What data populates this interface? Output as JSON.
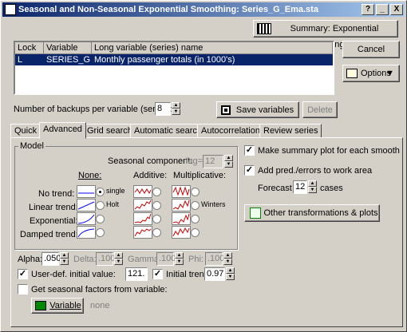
{
  "title": "Seasonal and Non-Seasonal Exponential Smoothing: Series_G_Ema.sta",
  "title_buttons": [
    "?",
    "_",
    "X"
  ],
  "summary_btn": "Summary:  Exponential smoothing)",
  "cancel_btn": "Cancel",
  "options_btn": "Options",
  "list": {
    "headers": [
      "Lock",
      "Variable",
      "Long variable (series) name"
    ],
    "row": [
      "L",
      "SERIES_G",
      "Monthly passenger totals (in 1000's)"
    ]
  },
  "backups_label": "Number of backups per variable (series):",
  "backups_value": "8",
  "save_btn": "Save variables",
  "delete_btn": "Delete",
  "tabs": [
    "Quick",
    "Advanced",
    "Grid search",
    "Automatic search",
    "Autocorrelations",
    "Review series"
  ],
  "model": {
    "group": "Model",
    "seasonal_label": "Seasonal component:",
    "lag_label": "lag=",
    "lag_value": "12",
    "col_none": "None:",
    "col_additive": "Additive:",
    "col_mult": "Multiplicative:",
    "rows": [
      "No trend:",
      "Linear trend:",
      "Exponential:",
      "Damped trend:"
    ],
    "single": "single",
    "holt": "Holt",
    "winters": "Winters"
  },
  "params": {
    "alpha_label": "Alpha:",
    "alpha": ".050",
    "delta_label": "Delta:",
    "delta": ".100",
    "gamma_label": "Gamma:",
    "gamma": ".100",
    "phi_label": "Phi:",
    "phi": ".100"
  },
  "userdef_label": "User-def. initial value:",
  "userdef_value": "121.",
  "inittrend_label": "Initial trend:",
  "inittrend_value": "0.97",
  "seasonal_factors_label": "Get seasonal factors from variable:",
  "variable_btn": "Variable",
  "none_text": "none",
  "summary_plot_label": "Make summary plot for each smooth",
  "add_pred_label": "Add pred./errors to work area",
  "forecast_label": "Forecast",
  "forecast_value": "12",
  "cases_label": "cases",
  "other_btn": "Other transformations & plots"
}
